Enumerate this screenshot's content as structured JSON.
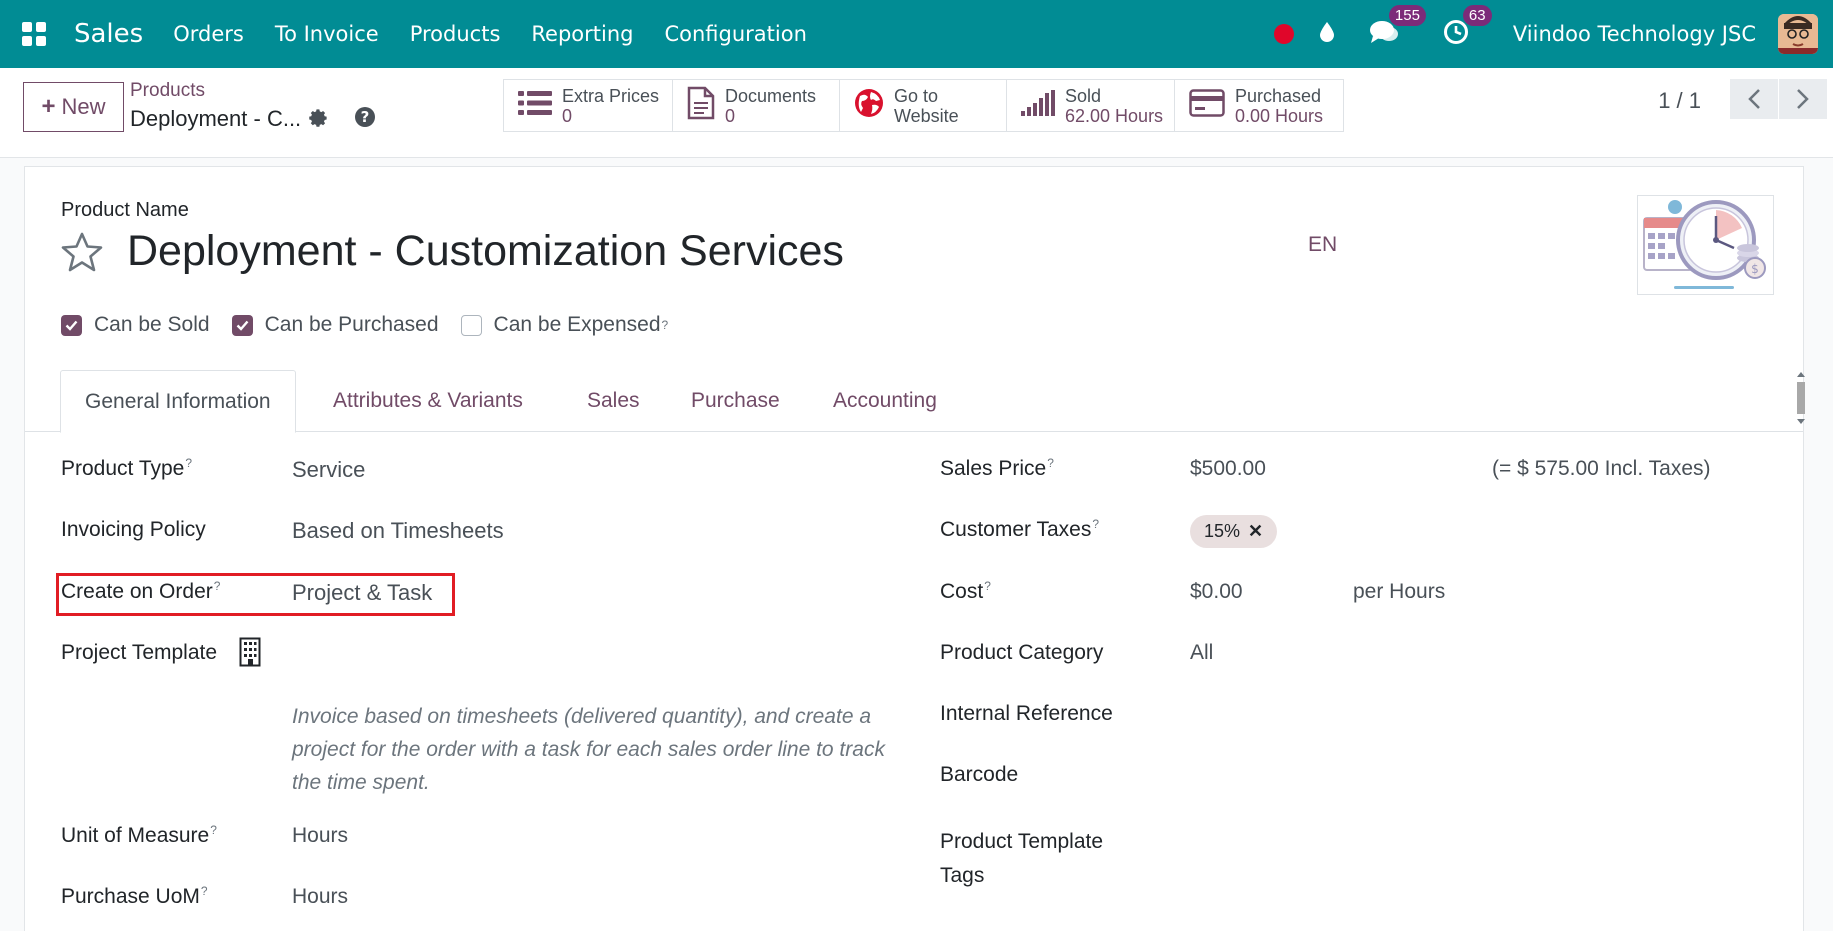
{
  "navbar": {
    "app_name": "Sales",
    "menu": [
      "Orders",
      "To Invoice",
      "Products",
      "Reporting",
      "Configuration"
    ],
    "messages_count": "155",
    "activities_count": "63",
    "company": "Viindoo Technology JSC",
    "bg_color": "#018c94",
    "icons": [
      "apps-grid-icon",
      "recording-dot-icon",
      "water-drop-icon",
      "chat-bubble-icon",
      "clock-activity-icon",
      "user-avatar"
    ]
  },
  "control_panel": {
    "new_label": "New",
    "breadcrumb_parent": "Products",
    "breadcrumb_current": "Deployment - C...",
    "smart_buttons": [
      {
        "label": "Extra Prices",
        "value": "0",
        "icon": "list-icon"
      },
      {
        "label": "Documents",
        "value": "0",
        "icon": "document-icon"
      },
      {
        "label": "Go to",
        "value": "Website",
        "icon": "globe-icon"
      },
      {
        "label": "Sold",
        "value": "62.00 Hours",
        "icon": "signal-bars-icon"
      },
      {
        "label": "Purchased",
        "value": "0.00 Hours",
        "icon": "credit-card-icon"
      }
    ],
    "pager": "1 / 1"
  },
  "form": {
    "product_name_label": "Product Name",
    "product_name": "Deployment - Customization Services",
    "lang": "EN",
    "checkboxes": {
      "can_be_sold": {
        "label": "Can be Sold",
        "checked": true
      },
      "can_be_purchased": {
        "label": "Can be Purchased",
        "checked": true
      },
      "can_be_expensed": {
        "label": "Can be Expensed",
        "checked": false
      }
    },
    "tabs": [
      "General Information",
      "Attributes & Variants",
      "Sales",
      "Purchase",
      "Accounting"
    ],
    "active_tab": "General Information",
    "left": {
      "product_type": {
        "label": "Product Type",
        "value": "Service"
      },
      "invoicing_policy": {
        "label": "Invoicing Policy",
        "value": "Based on Timesheets"
      },
      "create_on_order": {
        "label": "Create on Order",
        "value": "Project & Task"
      },
      "project_template": {
        "label": "Project Template",
        "value": ""
      },
      "help_text": "Invoice based on timesheets (delivered quantity), and create a project for the order with a task for each sales order line to track the time spent.",
      "uom": {
        "label": "Unit of Measure",
        "value": "Hours"
      },
      "purchase_uom": {
        "label": "Purchase UoM",
        "value": "Hours"
      }
    },
    "right": {
      "sales_price": {
        "label": "Sales Price",
        "value": "$500.00",
        "incl_taxes": "(= $ 575.00 Incl. Taxes)"
      },
      "customer_taxes": {
        "label": "Customer Taxes",
        "tag": "15%"
      },
      "cost": {
        "label": "Cost",
        "value": "$0.00",
        "unit": "per Hours"
      },
      "product_category": {
        "label": "Product Category",
        "value": "All"
      },
      "internal_reference": {
        "label": "Internal Reference",
        "value": ""
      },
      "barcode": {
        "label": "Barcode",
        "value": ""
      },
      "product_template_tags": {
        "label_line1": "Product Template",
        "label_line2": "Tags"
      }
    },
    "help_mark": "?",
    "accent_color": "#714b67",
    "highlight_color": "#e11d24"
  }
}
